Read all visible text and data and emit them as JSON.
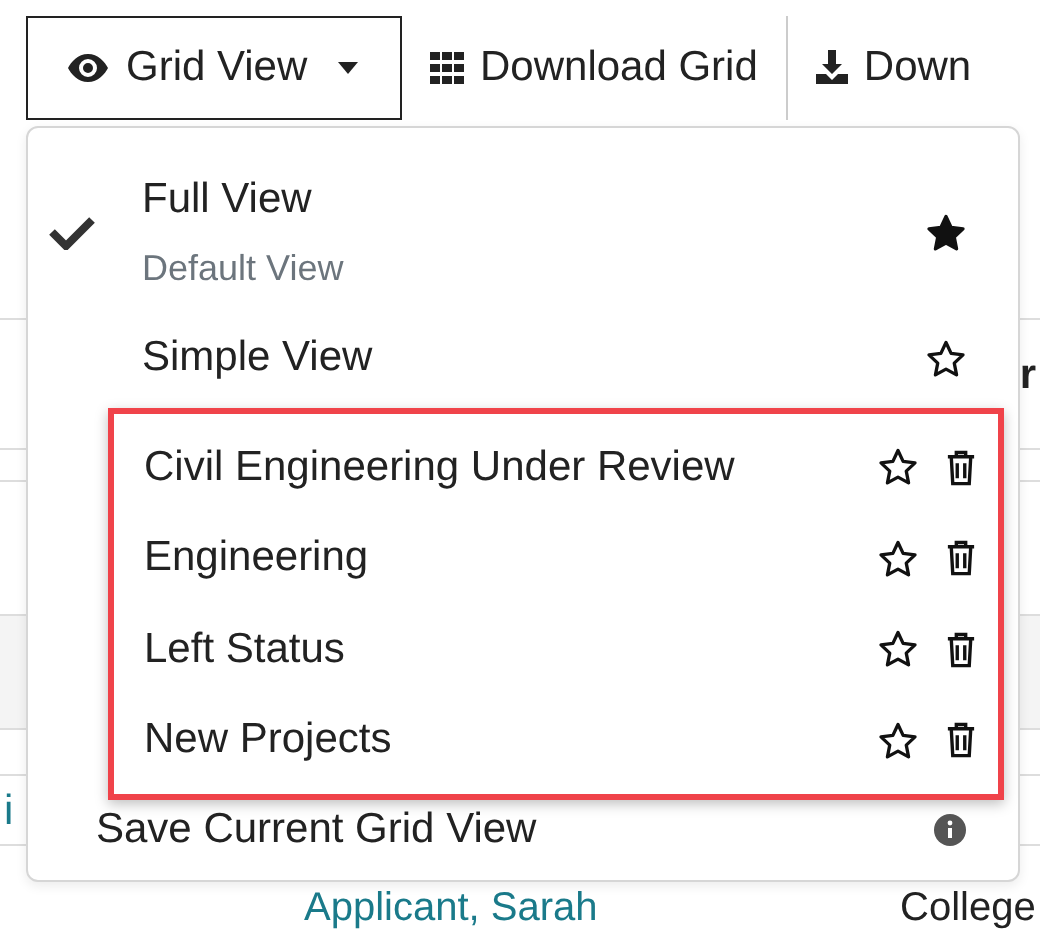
{
  "toolbar": {
    "view_button": {
      "label": "Grid View",
      "expanded": true
    },
    "buttons": [
      {
        "label": "Download Grid",
        "kind": "grid"
      },
      {
        "label": "Down",
        "kind": "download"
      }
    ]
  },
  "menu": {
    "views": [
      {
        "label": "Full View",
        "sublabel": "Default View",
        "selected": true,
        "favorite": true
      },
      {
        "label": "Simple View",
        "selected": false,
        "favorite": false
      }
    ],
    "saved_views": {
      "highlighted": true,
      "items": [
        {
          "label": "Civil Engineering Under Review",
          "favorite": false
        },
        {
          "label": "Engineering",
          "favorite": false
        },
        {
          "label": "Left Status",
          "favorite": false
        },
        {
          "label": "New Projects",
          "favorite": false
        }
      ]
    },
    "footer": {
      "label": "Save Current Grid View"
    }
  },
  "background": {
    "header_fragment": "r",
    "link_fragment": "i",
    "row": {
      "name": "Applicant, Sarah",
      "column_2": "College"
    }
  }
}
